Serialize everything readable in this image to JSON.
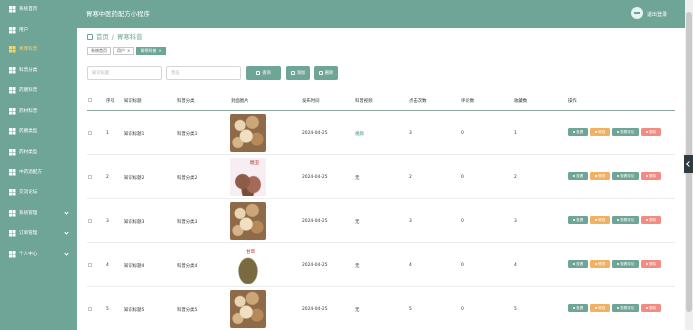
{
  "header": {
    "app_title": "胃寒中医药配方小程序",
    "logout": "退出登录"
  },
  "sidebar": {
    "items": [
      {
        "label": "系统首页",
        "active": false,
        "arrow": false
      },
      {
        "label": "用户",
        "active": false,
        "arrow": false
      },
      {
        "label": "胃寒科普",
        "active": true,
        "arrow": false
      },
      {
        "label": "科普分类",
        "active": false,
        "arrow": false
      },
      {
        "label": "药膳科普",
        "active": false,
        "arrow": false
      },
      {
        "label": "药材科普",
        "active": false,
        "arrow": false
      },
      {
        "label": "药膳类型",
        "active": false,
        "arrow": false
      },
      {
        "label": "药材类型",
        "active": false,
        "arrow": false
      },
      {
        "label": "中药酒配方",
        "active": false,
        "arrow": false
      },
      {
        "label": "交流论坛",
        "active": false,
        "arrow": false
      },
      {
        "label": "系统管理",
        "active": false,
        "arrow": true
      },
      {
        "label": "订单管理",
        "active": false,
        "arrow": true
      },
      {
        "label": "个人中心",
        "active": false,
        "arrow": true
      }
    ]
  },
  "breadcrumb": {
    "home": "首页",
    "sep": "/",
    "current": "胃寒科普"
  },
  "tabs": [
    {
      "label": "系统首页",
      "active": false
    },
    {
      "label": "用户",
      "active": false,
      "close": "×"
    },
    {
      "label": "胃寒科普",
      "active": true,
      "close": "×"
    }
  ],
  "search": {
    "title_placeholder": "知识标题",
    "status_placeholder": "状态",
    "search_label": "查询",
    "add_label": "添加",
    "delete_label": "删除"
  },
  "table": {
    "columns": [
      "序号",
      "知识标题",
      "科普分类",
      "封面图片",
      "发布时间",
      "科普视频",
      "点击次数",
      "评论数",
      "收藏数",
      "操作"
    ],
    "actions": {
      "view": "查看",
      "edit": "修改",
      "comments": "查看评论",
      "delete": "删除"
    },
    "rows": [
      {
        "index": "1",
        "title": "知识标题1",
        "category": "科普分类1",
        "image_caption": "",
        "date": "2024-04-25",
        "video": "视频",
        "clicks": "3",
        "comments": "0",
        "favorites": "1"
      },
      {
        "index": "2",
        "title": "知识标题2",
        "category": "科普分类2",
        "image_caption": "糖丑",
        "date": "2024-04-25",
        "video": "无",
        "clicks": "2",
        "comments": "0",
        "favorites": "2"
      },
      {
        "index": "3",
        "title": "知识标题3",
        "category": "科普分类3",
        "image_caption": "",
        "date": "2024-04-25",
        "video": "无",
        "clicks": "3",
        "comments": "0",
        "favorites": "3"
      },
      {
        "index": "4",
        "title": "知识标题4",
        "category": "科普分类4",
        "image_caption": "甘草",
        "date": "2024-04-25",
        "video": "无",
        "clicks": "4",
        "comments": "0",
        "favorites": "4"
      },
      {
        "index": "5",
        "title": "知识标题5",
        "category": "科普分类5",
        "image_caption": "",
        "date": "2024-04-25",
        "video": "无",
        "clicks": "5",
        "comments": "0",
        "favorites": "5"
      }
    ]
  },
  "colors": {
    "primary": "#6fa596",
    "edit": "#f0b260",
    "delete": "#f28b82",
    "active_menu": "#f7d26d"
  }
}
